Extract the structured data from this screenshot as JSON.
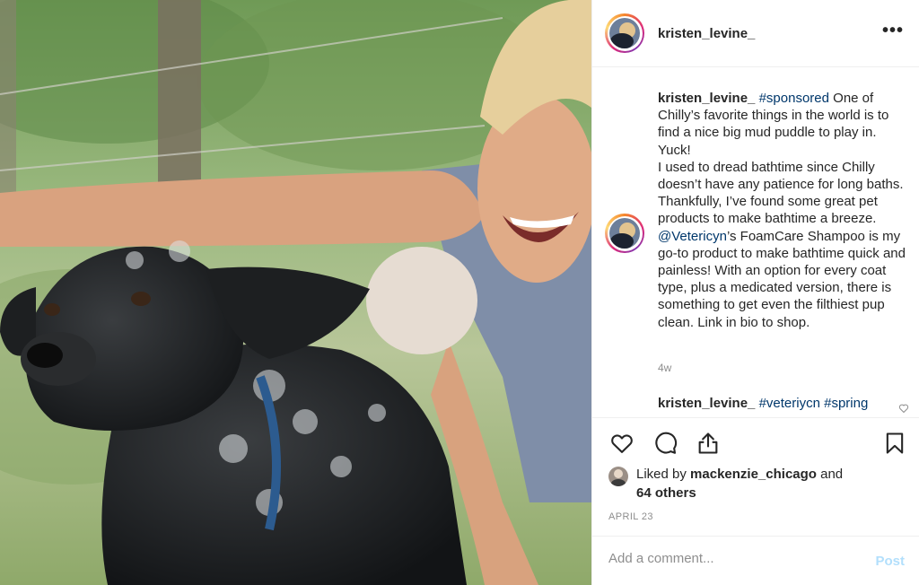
{
  "post": {
    "username": "kristen_levine_",
    "more_icon": "more-horizontal-icon",
    "more_label": "•••"
  },
  "caption": {
    "username": "kristen_levine_",
    "hashtag": "#sponsored",
    "text1": " One of Chilly’s favorite things in the world is to find a nice big mud puddle to play in. Yuck!",
    "text2": "I used to dread bathtime since Chilly doesn’t have any patience for long baths. Thankfully, I’ve found some great pet products to make bathtime a breeze.",
    "mention": "@Vetericyn",
    "text3": "’s FoamCare Shampoo is my go-to product to make bathtime quick and painless! With an option for every coat type, plus a medicated version, there is something to get even the filthiest pup clean. Link in bio to shop.",
    "time_ago": "4w"
  },
  "comment": {
    "username": "kristen_levine_",
    "tags": "#veteriycn #spring"
  },
  "actions": {
    "icons": [
      "heart-icon",
      "comment-icon",
      "share-icon",
      "bookmark-icon"
    ]
  },
  "likes": {
    "prefix": "Liked by ",
    "user": "mackenzie_chicago",
    "middle": " and",
    "others": "64 others"
  },
  "date": "APRIL 23",
  "add_comment": {
    "placeholder": "Add a comment...",
    "post_label": "Post"
  },
  "colors": {
    "link": "#00376b",
    "post_disabled": "#b2dffc",
    "muted": "#8e8e8e"
  }
}
